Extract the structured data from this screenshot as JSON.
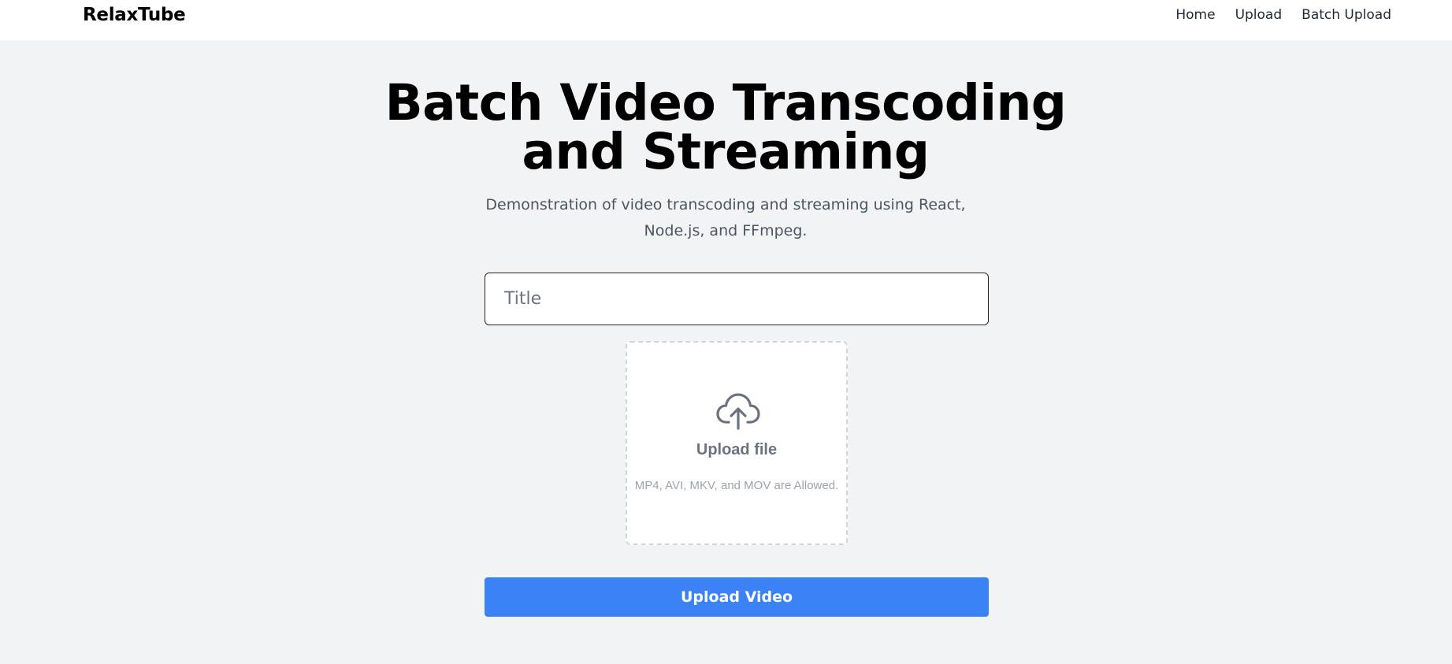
{
  "header": {
    "brand": "RelaxTube",
    "nav": [
      {
        "label": "Home"
      },
      {
        "label": "Upload"
      },
      {
        "label": "Batch Upload"
      }
    ]
  },
  "main": {
    "title": "Batch Video Transcoding and Streaming",
    "subtitle": "Demonstration of video transcoding and streaming using React, Node.js, and FFmpeg.",
    "title_input": {
      "placeholder": "Title",
      "value": ""
    },
    "dropzone": {
      "icon": "cloud-upload-icon",
      "title": "Upload file",
      "hint": "MP4, AVI, MKV, and MOV are Allowed."
    },
    "submit_label": "Upload Video"
  },
  "colors": {
    "background": "#f2f3f5",
    "accent": "#3b82f6",
    "muted_text": "#6b7280"
  }
}
